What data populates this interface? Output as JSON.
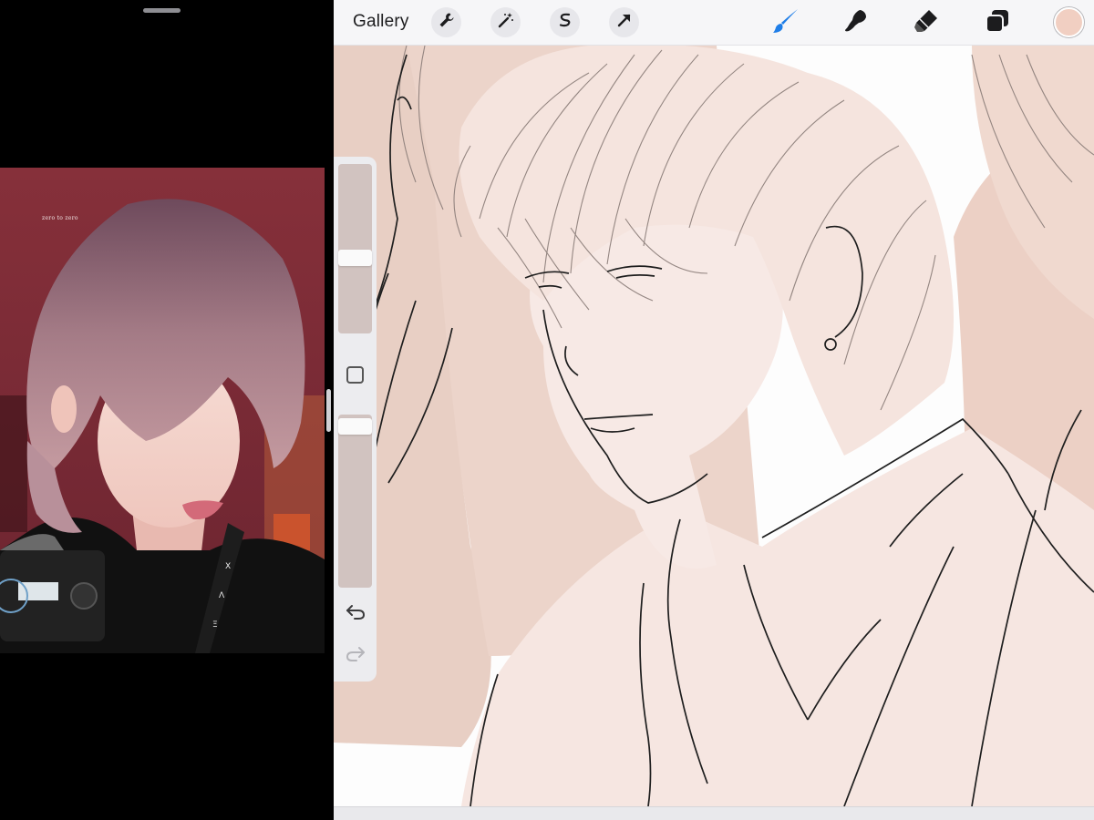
{
  "left_pane": {
    "reference_photo": {
      "watermark": "zero to zero",
      "background_color": "#7a2a34"
    }
  },
  "toolbar": {
    "gallery_label": "Gallery",
    "actions": [
      {
        "name": "wrench-icon"
      },
      {
        "name": "magic-wand-icon"
      },
      {
        "name": "selection-s-icon"
      },
      {
        "name": "transform-arrow-icon"
      }
    ],
    "tools": [
      {
        "name": "brush-icon",
        "color": "#1f7ee8"
      },
      {
        "name": "smudge-icon",
        "color": "#1c1c1e"
      },
      {
        "name": "eraser-icon",
        "color": "#1c1c1e"
      },
      {
        "name": "layers-icon",
        "color": "#1c1c1e"
      }
    ],
    "current_color": "#f1cfc2"
  },
  "sidebar": {
    "brush_size_level": 0.58,
    "opacity_level": 0.0,
    "undo_icon": "undo-arrow-icon",
    "redo_icon": "redo-arrow-icon"
  },
  "colors": {
    "canvas_skin": "#f7e8e3",
    "canvas_bg_pink": "#ecd2c8",
    "line": "#1e1e1e",
    "hair_lines": "#8a7c78"
  }
}
